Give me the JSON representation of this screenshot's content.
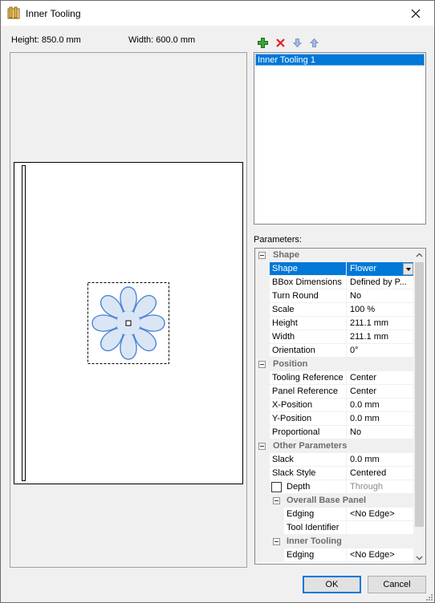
{
  "window": {
    "title": "Inner Tooling"
  },
  "dimensions": {
    "height_label": "Height: 850.0 mm",
    "width_label": "Width: 600.0 mm"
  },
  "toolbar": {
    "icons": [
      "add-icon",
      "delete-icon",
      "move-down-icon",
      "move-up-icon"
    ]
  },
  "tooling_list": {
    "items": [
      "Inner Tooling 1"
    ],
    "selected": "Inner Tooling 1"
  },
  "params": {
    "label": "Parameters:",
    "shape_cat": "Shape",
    "shape": {
      "name": "Shape",
      "value": "Flower"
    },
    "bbox": {
      "name": "BBox Dimensions",
      "value": "Defined by P..."
    },
    "turn_round": {
      "name": "Turn Round",
      "value": "No"
    },
    "scale": {
      "name": "Scale",
      "value": "100 %"
    },
    "height": {
      "name": "Height",
      "value": "211.1 mm"
    },
    "width": {
      "name": "Width",
      "value": "211.1 mm"
    },
    "orientation": {
      "name": "Orientation",
      "value": "0°"
    },
    "position_cat": "Position",
    "tooling_ref": {
      "name": "Tooling Reference",
      "value": "Center"
    },
    "panel_ref": {
      "name": "Panel Reference",
      "value": "Center"
    },
    "x_pos": {
      "name": "X-Position",
      "value": "0.0 mm"
    },
    "y_pos": {
      "name": "Y-Position",
      "value": "0.0 mm"
    },
    "proportional": {
      "name": "Proportional",
      "value": "No"
    },
    "other_cat": "Other Parameters",
    "slack": {
      "name": "Slack",
      "value": "0.0 mm"
    },
    "slack_style": {
      "name": "Slack Style",
      "value": "Centered"
    },
    "depth": {
      "name": "Depth",
      "value": "Through",
      "checked": false
    },
    "base_panel_cat": "Overall Base Panel",
    "edging1": {
      "name": "Edging",
      "value": "<No Edge>"
    },
    "tool_id": {
      "name": "Tool Identifier",
      "value": ""
    },
    "inner_tooling_cat": "Inner Tooling",
    "edging2": {
      "name": "Edging",
      "value": "<No Edge>"
    }
  },
  "buttons": {
    "ok": "OK",
    "cancel": "Cancel"
  }
}
